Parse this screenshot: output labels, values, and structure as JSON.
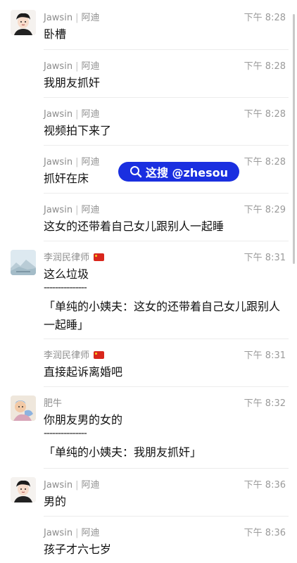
{
  "comments": [
    {
      "name": "Jawsin",
      "tag": "阿迪",
      "time": "下午 8:28",
      "text": "卧槽",
      "avatar": "person-avatar"
    },
    {
      "name": "Jawsin",
      "tag": "阿迪",
      "time": "下午 8:28",
      "text": "我朋友抓奸"
    },
    {
      "name": "Jawsin",
      "tag": "阿迪",
      "time": "下午 8:28",
      "text": "视频拍下来了"
    },
    {
      "name": "Jawsin",
      "tag": "阿迪",
      "time": "下午 8:28",
      "text": "抓奸在床"
    },
    {
      "name": "Jawsin",
      "tag": "阿迪",
      "time": "下午 8:29",
      "text": "这女的还带着自己女儿跟别人一起睡"
    },
    {
      "name": "李润民律师",
      "time": "下午 8:31",
      "text": "这么垃圾",
      "divider": "---------------",
      "quote": "「单纯的小姨夫：这女的还带着自己女儿跟别人一起睡」",
      "avatar": "landscape-avatar"
    },
    {
      "name": "李润民律师",
      "time": "下午 8:31",
      "text": "直接起诉离婚吧"
    },
    {
      "name": "肥牛",
      "time": "下午 8:32",
      "text": "你朋友男的女的",
      "divider": "---------------",
      "quote": "「单纯的小姨夫：我朋友抓奸」",
      "avatar": "cartoon-avatar"
    },
    {
      "name": "Jawsin",
      "tag": "阿迪",
      "time": "下午 8:36",
      "text": "男的",
      "avatar": "person-avatar"
    },
    {
      "name": "Jawsin",
      "tag": "阿迪",
      "time": "下午 8:36",
      "text": "孩子才六七岁"
    }
  ],
  "watermark": {
    "text": "这搜 @zhesou",
    "icon": "search-icon"
  }
}
